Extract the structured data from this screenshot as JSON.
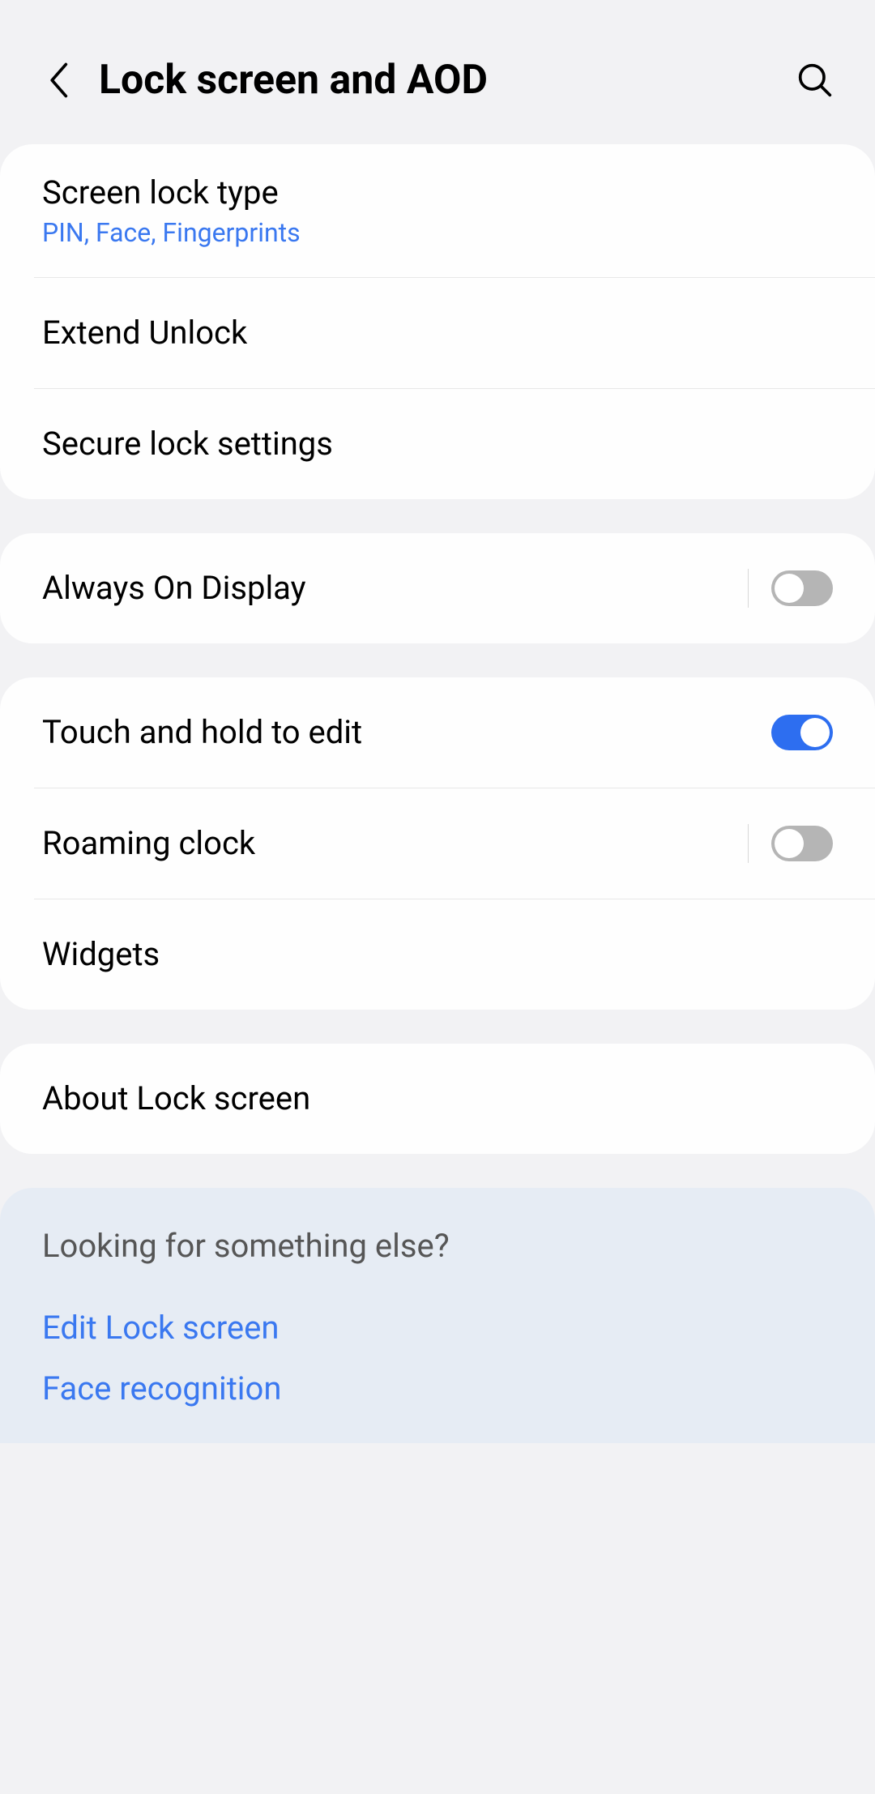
{
  "header": {
    "title": "Lock screen and AOD"
  },
  "sections": {
    "lock": {
      "screen_lock_type": {
        "title": "Screen lock type",
        "subtitle": "PIN, Face, Fingerprints"
      },
      "extend_unlock": {
        "title": "Extend Unlock"
      },
      "secure_lock": {
        "title": "Secure lock settings"
      }
    },
    "aod": {
      "always_on": {
        "title": "Always On Display"
      }
    },
    "customize": {
      "touch_hold": {
        "title": "Touch and hold to edit"
      },
      "roaming_clock": {
        "title": "Roaming clock"
      },
      "widgets": {
        "title": "Widgets"
      }
    },
    "about": {
      "about_lock": {
        "title": "About Lock screen"
      }
    }
  },
  "footer": {
    "heading": "Looking for something else?",
    "links": {
      "edit_lock": "Edit Lock screen",
      "face_recognition": "Face recognition"
    }
  }
}
